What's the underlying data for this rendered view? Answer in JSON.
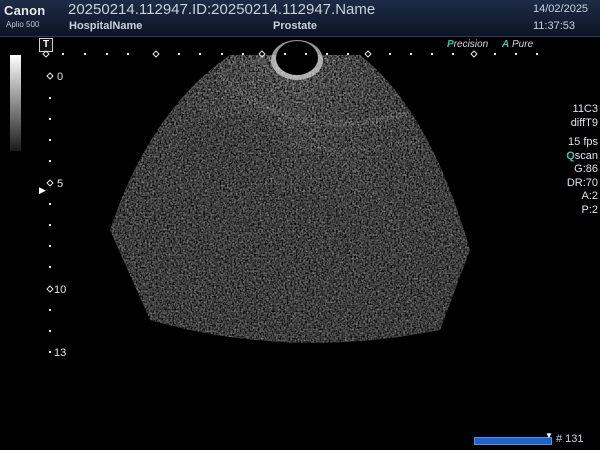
{
  "header": {
    "brand": "Canon",
    "model": "Aplio 500",
    "patient_id": "20250214.112947.ID:20250214.112947.Name",
    "hospital": "HospitalName",
    "exam": "Prostate",
    "date": "14/02/2025",
    "time": "11:37:53"
  },
  "image": {
    "t_marker": "T",
    "precision_prefix": "P",
    "precision_rest": "recision",
    "pure_prefix": "A",
    "pure_rest": " Pure",
    "depth_labels": [
      "0",
      "5",
      "10",
      "13"
    ],
    "focus_marker": "▶"
  },
  "params": {
    "probe": "11C3",
    "preset": "diffT9",
    "fps": "15 fps",
    "qscan_prefix": "Q",
    "qscan_rest": "scan",
    "gain": "G:86",
    "dynamic_range": "DR:70",
    "a": "A:2",
    "p": "P:2"
  },
  "cine": {
    "frame": "# 131",
    "position": 0.93
  },
  "colors": {
    "header_bg": "#14213a",
    "accent_teal": "#3fbfae",
    "cine_blue": "#1f63c9"
  }
}
